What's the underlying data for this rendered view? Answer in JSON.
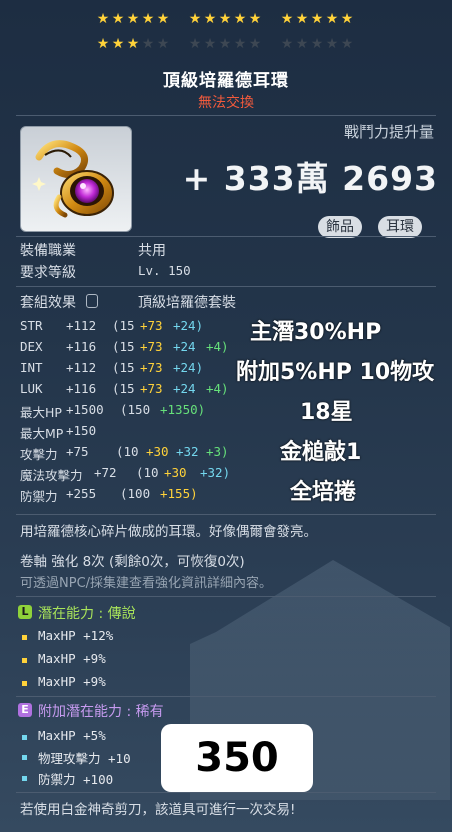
{
  "stars": {
    "row1": [
      true,
      true,
      true,
      true,
      true,
      true,
      true,
      true,
      true,
      true,
      true,
      true,
      true,
      true,
      true
    ],
    "row2": [
      true,
      true,
      true,
      false,
      false,
      false,
      false,
      false,
      false,
      false,
      false,
      false,
      false,
      false,
      false
    ]
  },
  "item": {
    "name": "頂級培羅德耳環",
    "trade_status": "無法交換",
    "icon": "earring-icon",
    "power_label": "戰鬥力提升量",
    "power_value": "+ 333萬 2693",
    "tags": [
      "飾品",
      "耳環"
    ]
  },
  "requirements": {
    "job_label": "裝備職業",
    "job_value": "共用",
    "level_label": "要求等級",
    "level_value": "Lv. 150"
  },
  "set": {
    "label": "套組效果",
    "name": "頂級培羅德套裝"
  },
  "stats": [
    {
      "name": "STR",
      "total": "+112",
      "p1": "(15",
      "p2": "+73",
      "p3": "+24)",
      "p4": ""
    },
    {
      "name": "DEX",
      "total": "+116",
      "p1": "(15",
      "p2": "+73",
      "p3": "+24",
      "p4": "+4)"
    },
    {
      "name": "INT",
      "total": "+112",
      "p1": "(15",
      "p2": "+73",
      "p3": "+24)",
      "p4": ""
    },
    {
      "name": "LUK",
      "total": "+116",
      "p1": "(15",
      "p2": "+73",
      "p3": "+24",
      "p4": "+4)"
    },
    {
      "name": "最大HP",
      "total": "+1500",
      "p1": "(150",
      "p2": "+1350)",
      "p3": "",
      "p4": ""
    },
    {
      "name": "最大MP",
      "total": "+150",
      "p1": "",
      "p2": "",
      "p3": "",
      "p4": ""
    },
    {
      "name": "攻擊力",
      "total": "+75",
      "p1": "(10",
      "p2": "+30",
      "p3": "+32",
      "p4": "+3)"
    },
    {
      "name": "魔法攻擊力",
      "total": "+72",
      "p1": "(10",
      "p2": "+30",
      "p3": "+32)",
      "p4": ""
    },
    {
      "name": "防禦力",
      "total": "+255",
      "p1": "(100",
      "p2": "+155)",
      "p3": "",
      "p4": ""
    }
  ],
  "overlay_notes": [
    "主潛30%HP",
    "附加5%HP 10物攻",
    "18星",
    "金槌敲1",
    "全培捲"
  ],
  "description": "用培羅德核心碎片做成的耳環。好像偶爾會發亮。",
  "scroll_info": "卷軸 強化 8次 (剩餘0次，可恢復0次)",
  "hint": "可透過NPC/採集建查看強化資訊詳細內容。",
  "potential": {
    "grade_letter": "L",
    "label": "潛在能力 : 傳說",
    "lines": [
      "MaxHP +12%",
      "MaxHP +9%",
      "MaxHP +9%"
    ]
  },
  "bonus_potential": {
    "grade_letter": "E",
    "label": "附加潛在能力 : 稀有",
    "lines": [
      "MaxHP +5%",
      "物理攻擊力 +10",
      "防禦力 +100"
    ]
  },
  "price_box": "350",
  "footer": "若使用白金神奇剪刀，該道具可進行一次交易!",
  "colors": {
    "star_on": "#ffd23a",
    "star_off": "#3d4753",
    "untradeable": "#f05a3c",
    "legendary": "#8fd23a",
    "epic_purple": "#b071e0"
  }
}
